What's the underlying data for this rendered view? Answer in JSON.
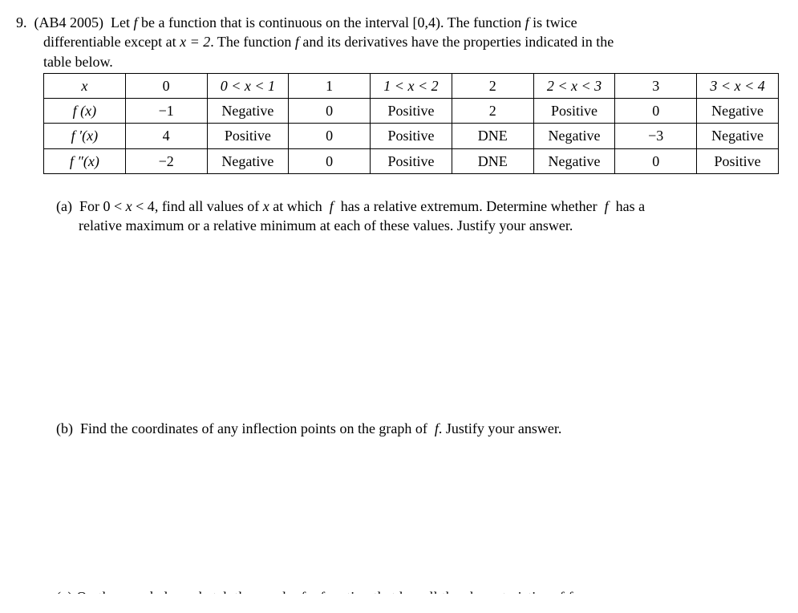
{
  "problem": {
    "number": "9.",
    "source": "(AB4 2005)",
    "stem_line1_a": "Let ",
    "stem_line1_b": " be a function that is continuous on the interval ",
    "interval": "[0,4)",
    "stem_line1_c": ".  The function ",
    "stem_line1_d": " is twice",
    "stem_line2_a": "differentiable except at ",
    "stem_line2_eq": "x = 2",
    "stem_line2_b": ".  The function ",
    "stem_line2_c": " and its derivatives have the properties indicated in the",
    "stem_line3": "table below."
  },
  "table": {
    "row_x": [
      "x",
      "0",
      "0 < x < 1",
      "1",
      "1 < x < 2",
      "2",
      "2 < x < 3",
      "3",
      "3 < x < 4"
    ],
    "row_f": [
      "f (x)",
      "−1",
      "Negative",
      "0",
      "Positive",
      "2",
      "Positive",
      "0",
      "Negative"
    ],
    "row_fp": [
      "f ′(x)",
      "4",
      "Positive",
      "0",
      "Positive",
      "DNE",
      "Negative",
      "−3",
      "Negative"
    ],
    "row_fpp": [
      "f ″(x)",
      "−2",
      "Negative",
      "0",
      "Positive",
      "DNE",
      "Negative",
      "0",
      "Positive"
    ]
  },
  "parts": {
    "a": {
      "label": "(a)",
      "line1_a": "For ",
      "line1_ineq": "0 < x < 4",
      "line1_b": ", find all values of ",
      "line1_c": " at which ",
      "line1_d": " has a relative extremum.  Determine whether ",
      "line1_e": " has a",
      "line2": "relative maximum or a relative minimum at each of these values.  Justify your answer."
    },
    "b": {
      "label": "(b)",
      "text_a": "Find the coordinates of any inflection points on the graph of ",
      "text_b": ".  Justify your answer."
    }
  },
  "cutoff_text": "(c)  On the axes below, sketch the graph of a function that has all the characteristics of  f"
}
